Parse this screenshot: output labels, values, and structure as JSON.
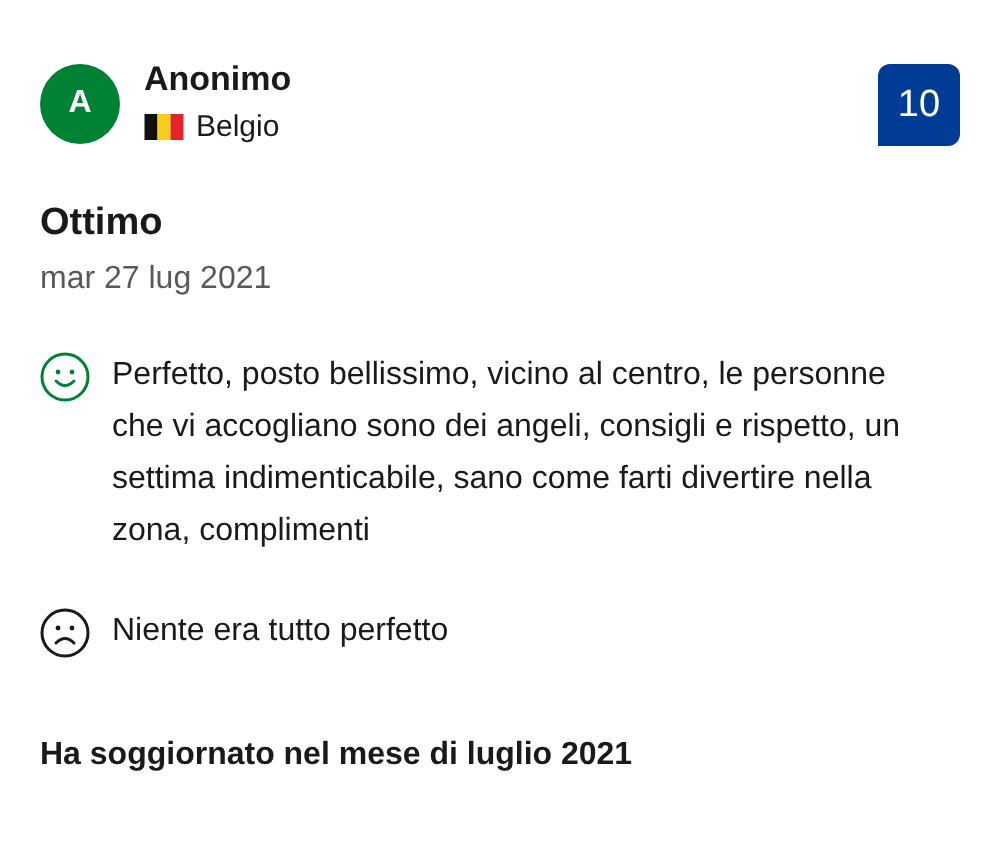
{
  "reviewer": {
    "initial": "A",
    "name": "Anonimo",
    "country": "Belgio"
  },
  "score": "10",
  "title": "Ottimo",
  "date": "mar 27 lug 2021",
  "comments": [
    {
      "kind": "positive",
      "text": "Perfetto, posto bellissimo, vicino al centro, le personne che vi accogliano sono dei angeli, consigli e rispetto, un settima indimenticabile, sano come farti divertire nella zona, complimenti"
    },
    {
      "kind": "negative",
      "text": "Niente era tutto perfetto"
    }
  ],
  "stay": "Ha soggiornato nel mese di luglio 2021"
}
